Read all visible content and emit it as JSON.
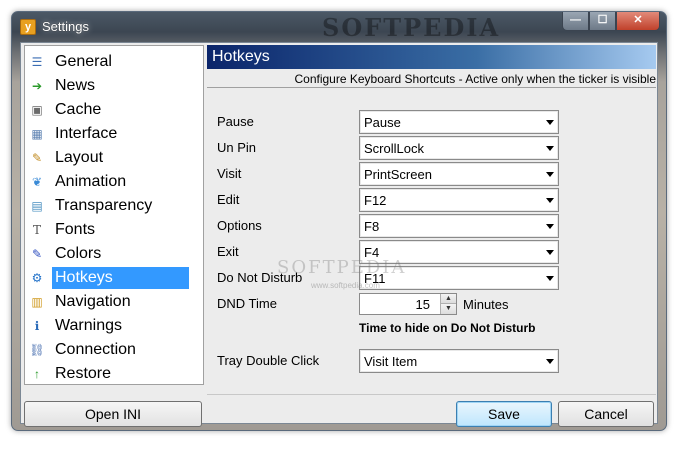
{
  "window": {
    "title": "Settings",
    "app_icon": "ticker-app-icon",
    "title_watermark": "SOFTPEDIA",
    "controls": {
      "minimize": "—",
      "maximize": "☐",
      "close": "✕"
    }
  },
  "sidebar": {
    "items": [
      {
        "label": "General",
        "icon": "general-list-icon",
        "glyph": "☰",
        "color": "#3b6db3",
        "active": false
      },
      {
        "label": "News",
        "icon": "news-arrow-icon",
        "glyph": "➔",
        "color": "#2a9a2a",
        "active": false
      },
      {
        "label": "Cache",
        "icon": "cache-box-icon",
        "glyph": "▣",
        "color": "#6b6b6b",
        "active": false
      },
      {
        "label": "Interface",
        "icon": "interface-grid-icon",
        "glyph": "▦",
        "color": "#5a7fb0",
        "active": false
      },
      {
        "label": "Layout",
        "icon": "layout-pencil-icon",
        "glyph": "✎",
        "color": "#c08a20",
        "active": false
      },
      {
        "label": "Animation",
        "icon": "animation-butterfly-icon",
        "glyph": "❦",
        "color": "#3a8ad6",
        "active": false
      },
      {
        "label": "Transparency",
        "icon": "transparency-monitor-icon",
        "glyph": "▤",
        "color": "#4a90c0",
        "active": false
      },
      {
        "label": "Fonts",
        "icon": "fonts-page-icon",
        "glyph": "T",
        "color": "#555555",
        "active": false
      },
      {
        "label": "Colors",
        "icon": "colors-palette-icon",
        "glyph": "✎",
        "color": "#3050c0",
        "active": false
      },
      {
        "label": "Hotkeys",
        "icon": "hotkeys-gear-icon",
        "glyph": "⚙",
        "color": "#1e6fc8",
        "active": true
      },
      {
        "label": "Navigation",
        "icon": "navigation-compass-icon",
        "glyph": "▥",
        "color": "#d09a20",
        "active": false
      },
      {
        "label": "Warnings",
        "icon": "warnings-info-icon",
        "glyph": "ℹ",
        "color": "#2a6ab8",
        "active": false
      },
      {
        "label": "Connection",
        "icon": "connection-network-icon",
        "glyph": "⛓",
        "color": "#4a70b0",
        "active": false
      },
      {
        "label": "Restore",
        "icon": "restore-arrow-icon",
        "glyph": "↑",
        "color": "#2a9a2a",
        "active": false
      }
    ],
    "open_ini_label": "Open INI"
  },
  "panel": {
    "title": "Hotkeys",
    "subtitle": "Configure Keyboard Shortcuts - Active only when the ticker is visible"
  },
  "hotkeys": [
    {
      "label": "Pause",
      "value": "Pause"
    },
    {
      "label": "Un Pin",
      "value": "ScrollLock"
    },
    {
      "label": "Visit",
      "value": "PrintScreen"
    },
    {
      "label": "Edit",
      "value": "F12"
    },
    {
      "label": "Options",
      "value": "F8"
    },
    {
      "label": "Exit",
      "value": "F4"
    },
    {
      "label": "Do Not Disturb",
      "value": "F11"
    }
  ],
  "dnd": {
    "label": "DND Time",
    "value": "15",
    "unit": "Minutes",
    "note": "Time to hide on Do Not Disturb"
  },
  "tray": {
    "label": "Tray Double Click",
    "value": "Visit Item"
  },
  "watermark": {
    "text": "SOFTPEDIA",
    "url": "www.softpedia.com"
  },
  "buttons": {
    "save": "Save",
    "cancel": "Cancel"
  }
}
